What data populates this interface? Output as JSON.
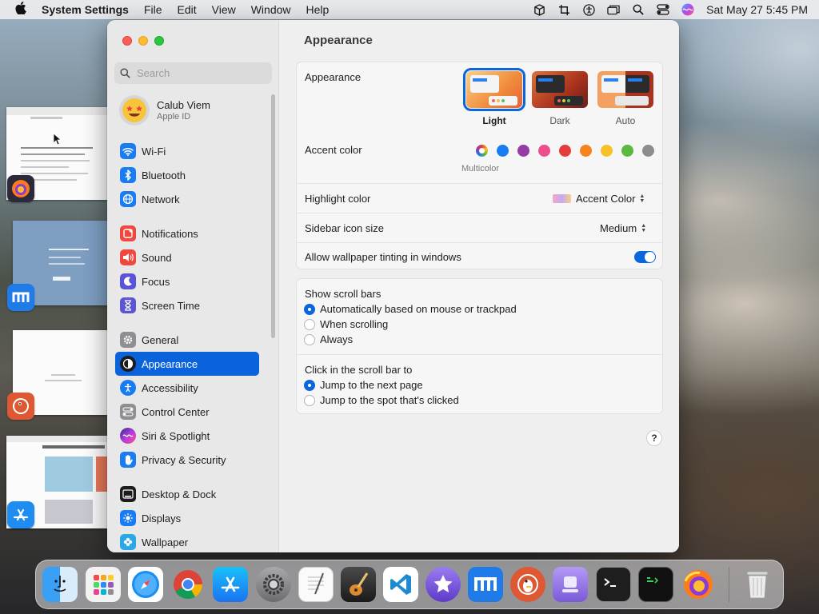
{
  "menubar": {
    "app_name": "System Settings",
    "menus": [
      "File",
      "Edit",
      "View",
      "Window",
      "Help"
    ],
    "clock": "Sat May 27  5:45 PM"
  },
  "sidebar": {
    "search_placeholder": "Search",
    "profile": {
      "name": "Calub Viem",
      "subtitle": "Apple ID"
    },
    "items": [
      {
        "label": "Wi-Fi",
        "icon": "wifi-icon",
        "color": "#1a7cf3"
      },
      {
        "label": "Bluetooth",
        "icon": "bluetooth-icon",
        "color": "#1a7cf3"
      },
      {
        "label": "Network",
        "icon": "globe-icon",
        "color": "#1a7cf3"
      },
      {
        "label": "Notifications",
        "icon": "bell-icon",
        "color": "#f0473e"
      },
      {
        "label": "Sound",
        "icon": "speaker-icon",
        "color": "#f0473e"
      },
      {
        "label": "Focus",
        "icon": "moon-icon",
        "color": "#5b55d6"
      },
      {
        "label": "Screen Time",
        "icon": "hourglass-icon",
        "color": "#5b55d6"
      },
      {
        "label": "General",
        "icon": "gear-icon",
        "color": "#8e8e93"
      },
      {
        "label": "Appearance",
        "icon": "appearance-icon",
        "color": "#1c1c1e"
      },
      {
        "label": "Accessibility",
        "icon": "accessibility-icon",
        "color": "#1a7cf3"
      },
      {
        "label": "Control Center",
        "icon": "control-center-icon",
        "color": "#8e8e93"
      },
      {
        "label": "Siri & Spotlight",
        "icon": "siri-icon",
        "color": "#9b3ce0"
      },
      {
        "label": "Privacy & Security",
        "icon": "hand-icon",
        "color": "#1a7cf3"
      },
      {
        "label": "Desktop & Dock",
        "icon": "dock-icon",
        "color": "#1c1c1e"
      },
      {
        "label": "Displays",
        "icon": "sun-icon",
        "color": "#1a7cf3"
      },
      {
        "label": "Wallpaper",
        "icon": "flower-icon",
        "color": "#2aa8e6"
      }
    ]
  },
  "content": {
    "title": "Appearance",
    "appearance": {
      "label": "Appearance",
      "options": [
        {
          "label": "Light",
          "selected": true
        },
        {
          "label": "Dark",
          "selected": false
        },
        {
          "label": "Auto",
          "selected": false
        }
      ]
    },
    "accent": {
      "label": "Accent color",
      "selected_name": "Multicolor",
      "colors": [
        "multicolor",
        "#1a7cf3",
        "#953ca6",
        "#ee4e8e",
        "#e23c3c",
        "#f5841f",
        "#f7c12a",
        "#5cb83e",
        "#8c8c8c"
      ]
    },
    "highlight": {
      "label": "Highlight color",
      "value": "Accent Color"
    },
    "sidebar_icon_size": {
      "label": "Sidebar icon size",
      "value": "Medium"
    },
    "wallpaper_tinting": {
      "label": "Allow wallpaper tinting in windows",
      "enabled": true
    },
    "scroll_bars": {
      "label": "Show scroll bars",
      "options": [
        {
          "label": "Automatically based on mouse or trackpad",
          "selected": true
        },
        {
          "label": "When scrolling",
          "selected": false
        },
        {
          "label": "Always",
          "selected": false
        }
      ]
    },
    "click_scroll": {
      "label": "Click in the scroll bar to",
      "options": [
        {
          "label": "Jump to the next page",
          "selected": true
        },
        {
          "label": "Jump to the spot that's clicked",
          "selected": false
        }
      ]
    },
    "help": "?"
  },
  "dock": {
    "apps": [
      "finder-icon",
      "launchpad-icon",
      "safari-icon",
      "chrome-icon",
      "app-store-icon",
      "system-settings-icon",
      "textedit-icon",
      "garageband-icon",
      "vscode-icon",
      "imovie-star-icon",
      "maxthon-icon",
      "duckduckgo-icon",
      "podcast-capture-icon",
      "terminal-icon",
      "script-editor-icon",
      "firefox-icon",
      "trash-icon"
    ]
  }
}
